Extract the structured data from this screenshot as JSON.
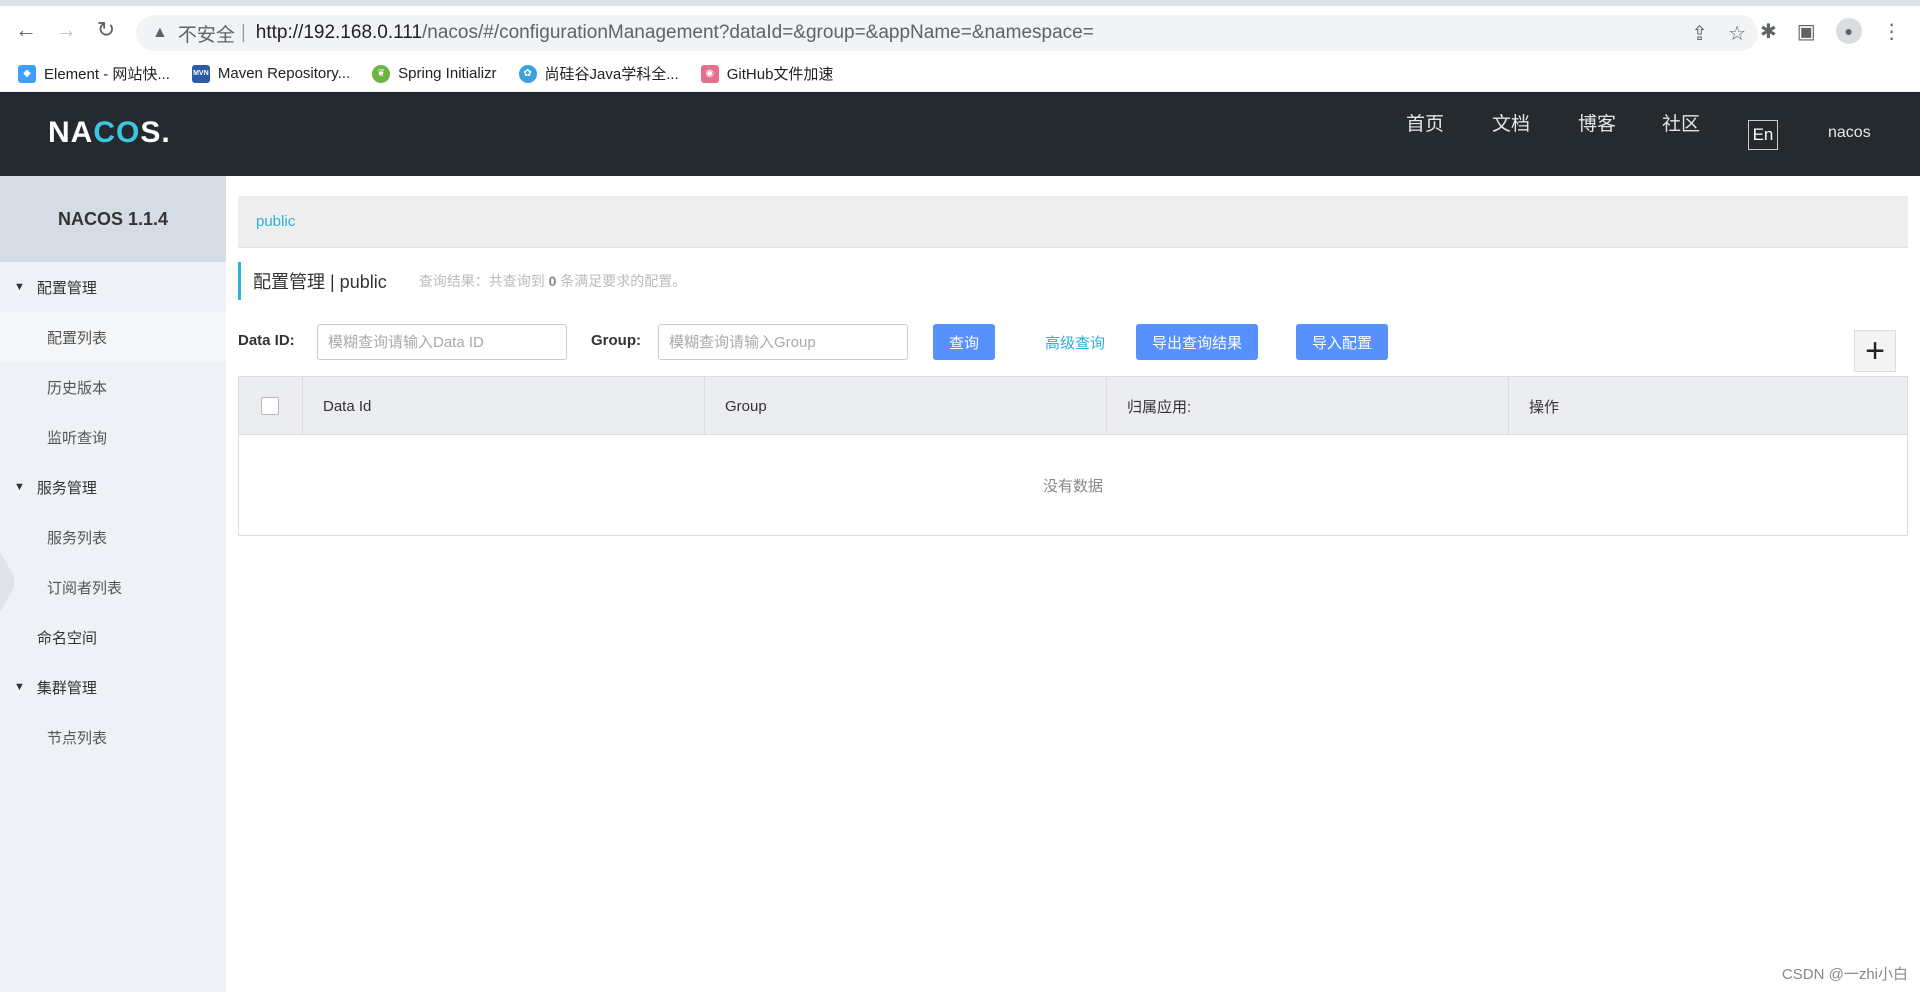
{
  "browser": {
    "insecure_label": "不安全",
    "separator": "|",
    "url_host": "http://192.168.0.111",
    "url_rest": "/nacos/#/configurationManagement?dataId=&group=&appName=&namespace="
  },
  "bookmarks": [
    {
      "label": "Element - 网站快..."
    },
    {
      "label": "Maven Repository..."
    },
    {
      "label": "Spring Initializr"
    },
    {
      "label": "尚硅谷Java学科全..."
    },
    {
      "label": "GitHub文件加速"
    }
  ],
  "header": {
    "logo_pre": "NA",
    "logo_mid": "CO",
    "logo_post": "S.",
    "nav": [
      "首页",
      "文档",
      "博客",
      "社区"
    ],
    "lang": "En",
    "user": "nacos"
  },
  "sidebar": {
    "title": "NACOS 1.1.4",
    "groups": [
      {
        "label": "配置管理",
        "items": [
          "配置列表",
          "历史版本",
          "监听查询"
        ]
      },
      {
        "label": "服务管理",
        "items": [
          "服务列表",
          "订阅者列表"
        ]
      },
      {
        "label": "命名空间"
      },
      {
        "label": "集群管理",
        "items": [
          "节点列表"
        ]
      }
    ]
  },
  "main": {
    "namespace": "public",
    "title": "配置管理 | public",
    "summary_pre": "查询结果：共查询到",
    "summary_count": "0",
    "summary_post": "条满足要求的配置。",
    "data_id_label": "Data ID:",
    "data_id_placeholder": "模糊查询请输入Data ID",
    "group_label": "Group:",
    "group_placeholder": "模糊查询请输入Group",
    "query_btn": "查询",
    "advanced_btn": "高级查询",
    "export_btn": "导出查询结果",
    "import_btn": "导入配置",
    "plus": "+",
    "columns": [
      "Data Id",
      "Group",
      "归属应用:",
      "操作"
    ],
    "empty_text": "没有数据"
  },
  "watermark": "CSDN @一zhi小白"
}
